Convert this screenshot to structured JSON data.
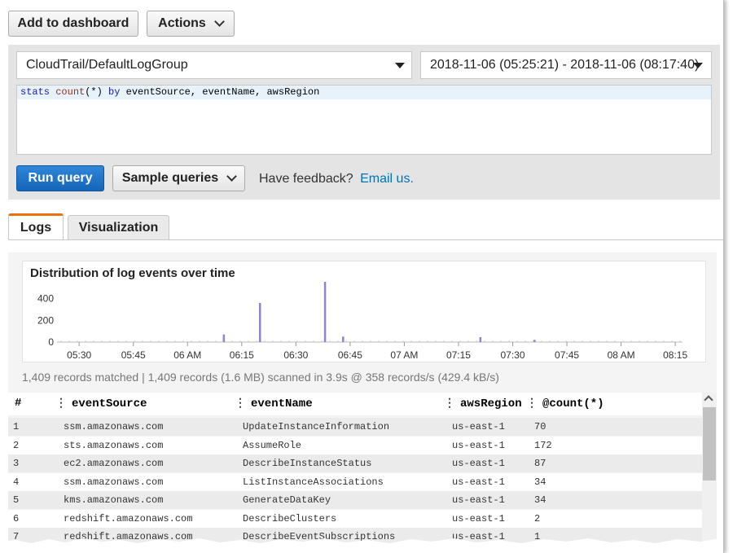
{
  "toolbar": {
    "add_to_dashboard": "Add to dashboard",
    "actions": "Actions"
  },
  "query": {
    "log_group": "CloudTrail/DefaultLogGroup",
    "time_range": "2018-11-06 (05:25:21) - 2018-11-06 (08:17:40)",
    "text": {
      "cmd": "stats",
      "fn": "count",
      "args": "(*)",
      "by": "by",
      "fields": "eventSource, eventName, awsRegion"
    },
    "run": "Run query",
    "sample": "Sample queries",
    "feedback": "Have feedback?",
    "email": "Email us."
  },
  "tabs": {
    "logs": "Logs",
    "visualization": "Visualization"
  },
  "chart_data": {
    "type": "bar",
    "title": "Distribution of log events over time",
    "y_ticks": [
      "400",
      "200",
      "0"
    ],
    "x_ticks": [
      "05:30",
      "05:45",
      "06 AM",
      "06:15",
      "06:30",
      "06:45",
      "07 AM",
      "07:15",
      "07:30",
      "07:45",
      "08 AM",
      "08:15"
    ],
    "ylim": [
      0,
      600
    ],
    "x": [
      "06:10",
      "06:20",
      "06:38",
      "06:43",
      "07:21",
      "07:36"
    ],
    "values": [
      70,
      360,
      555,
      50,
      45,
      20
    ],
    "color": "#8d84cc"
  },
  "summary": "1,409 records matched | 1,409 records (1.6 MB) scanned in 3.9s @ 358 records/s (429.4 kB/s)",
  "table": {
    "headers": {
      "num": "#",
      "source": "eventSource",
      "name": "eventName",
      "region": "awsRegion",
      "count": "@count(*)"
    },
    "rows": [
      [
        "1",
        "ssm.amazonaws.com",
        "UpdateInstanceInformation",
        "us-east-1",
        "70"
      ],
      [
        "2",
        "sts.amazonaws.com",
        "AssumeRole",
        "us-east-1",
        "172"
      ],
      [
        "3",
        "ec2.amazonaws.com",
        "DescribeInstanceStatus",
        "us-east-1",
        "87"
      ],
      [
        "4",
        "ssm.amazonaws.com",
        "ListInstanceAssociations",
        "us-east-1",
        "34"
      ],
      [
        "5",
        "kms.amazonaws.com",
        "GenerateDataKey",
        "us-east-1",
        "34"
      ],
      [
        "6",
        "redshift.amazonaws.com",
        "DescribeClusters",
        "us-east-1",
        "2"
      ],
      [
        "7",
        "redshift.amazonaws.com",
        "DescribeEventSubscriptions",
        "us-east-1",
        "1"
      ]
    ]
  }
}
